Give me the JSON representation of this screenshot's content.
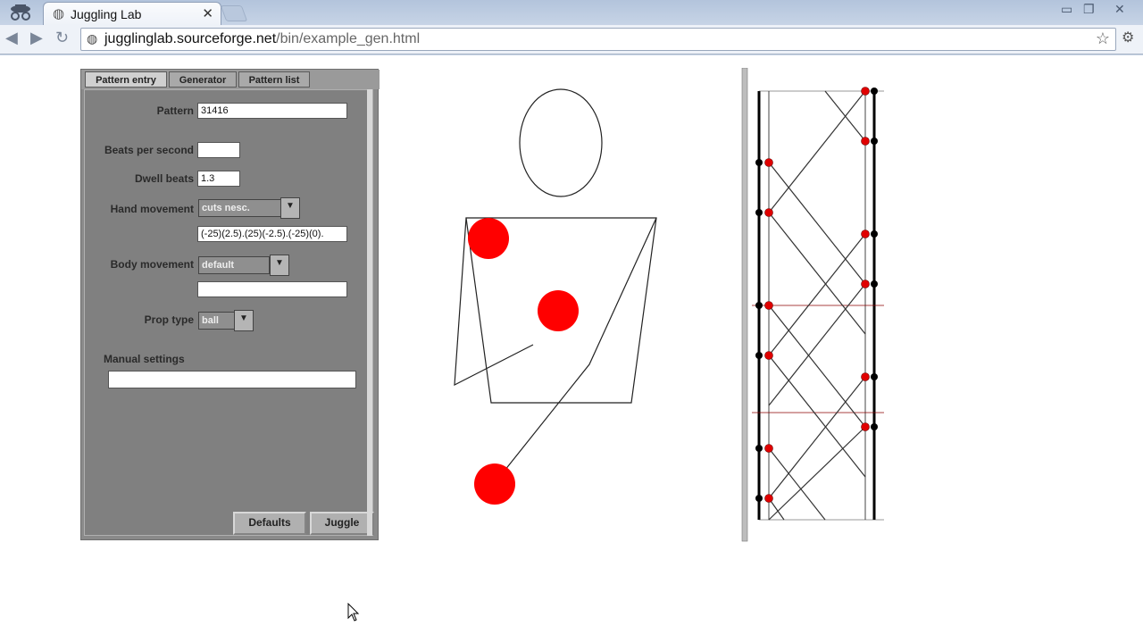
{
  "browser": {
    "tab_title": "Juggling Lab",
    "tab_close": "✕",
    "url_host": "jugglinglab.sourceforge.net",
    "url_path": "/bin/example_gen.html",
    "win_min": "▭",
    "win_max": "❐",
    "win_close": "✕"
  },
  "applet": {
    "tabs": [
      {
        "label": "Pattern entry"
      },
      {
        "label": "Generator"
      },
      {
        "label": "Pattern list"
      }
    ],
    "fields": {
      "pattern_label": "Pattern",
      "pattern_value": "31416",
      "beats_label": "Beats per second",
      "beats_value": "",
      "dwell_label": "Dwell beats",
      "dwell_value": "1.3",
      "hand_label": "Hand movement",
      "hand_value": "cuts nesc.",
      "hand_text": "(-25)(2.5).(25)(-2.5).(-25)(0).",
      "body_label": "Body movement",
      "body_value": "default",
      "body_text": "",
      "prop_label": "Prop type",
      "prop_value": "ball",
      "manual_label": "Manual settings",
      "manual_value": ""
    },
    "buttons": {
      "defaults": "Defaults",
      "juggle": "Juggle"
    }
  },
  "colors": {
    "ball": "#ff0000",
    "panel": "#8a8a8a"
  }
}
